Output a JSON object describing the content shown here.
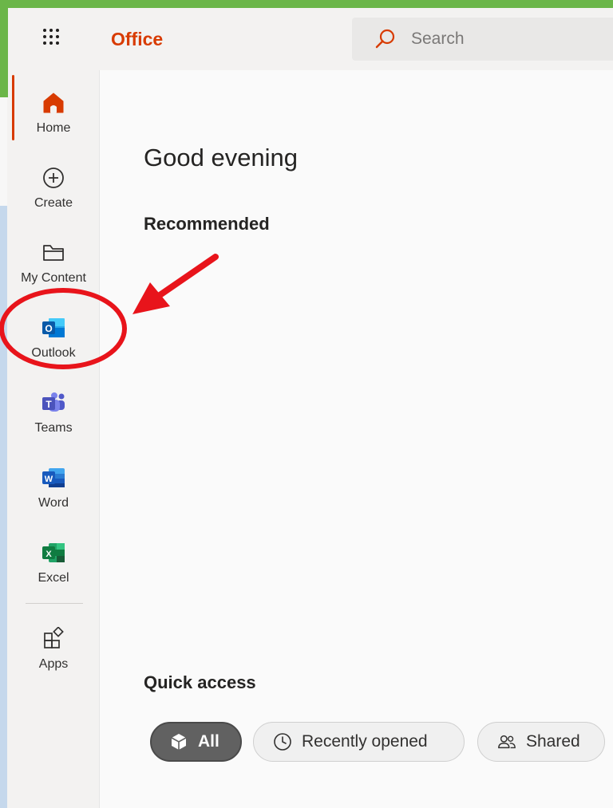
{
  "header": {
    "brand": "Office",
    "search_placeholder": "Search"
  },
  "rail": {
    "items": [
      {
        "label": "Home",
        "icon": "home-icon"
      },
      {
        "label": "Create",
        "icon": "plus-circle-icon"
      },
      {
        "label": "My Content",
        "icon": "folder-icon"
      },
      {
        "label": "Outlook",
        "icon": "outlook-icon"
      },
      {
        "label": "Teams",
        "icon": "teams-icon"
      },
      {
        "label": "Word",
        "icon": "word-icon"
      },
      {
        "label": "Excel",
        "icon": "excel-icon"
      },
      {
        "label": "Apps",
        "icon": "apps-icon"
      }
    ]
  },
  "main": {
    "greeting": "Good evening",
    "recommended_title": "Recommended",
    "quick_access_title": "Quick access",
    "filters": [
      {
        "label": "All",
        "icon": "cube-icon",
        "selected": true
      },
      {
        "label": "Recently opened",
        "icon": "clock-icon",
        "selected": false
      },
      {
        "label": "Shared",
        "icon": "people-icon",
        "selected": false
      }
    ]
  },
  "icon_letters": {
    "outlook": "O",
    "teams": "T",
    "word": "W",
    "excel": "X"
  },
  "colors": {
    "brand": "#d83b01",
    "annotation": "#e8141b",
    "frame_green": "#6bb649"
  }
}
